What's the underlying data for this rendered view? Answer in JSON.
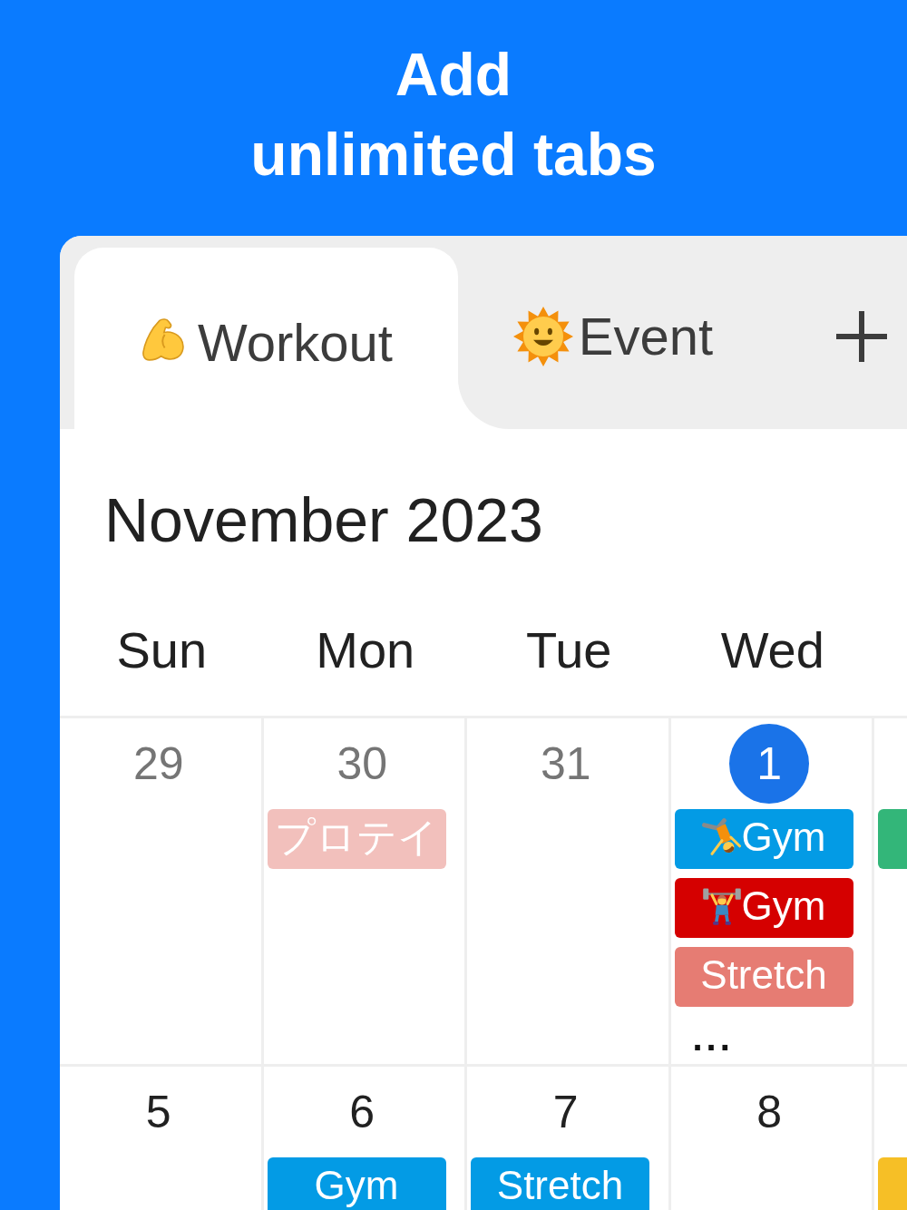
{
  "headline": "Add\nunlimited tabs",
  "tabs": [
    {
      "label": "Workout",
      "selected": true
    },
    {
      "label": "Event",
      "selected": false
    }
  ],
  "calendar": {
    "month_title": "November 2023",
    "weekdays": [
      "Sun",
      "Mon",
      "Tue",
      "Wed"
    ],
    "weeks": [
      {
        "days": [
          {
            "date": "29",
            "other_month": true,
            "today": false
          },
          {
            "date": "30",
            "other_month": true,
            "today": false,
            "events": [
              {
                "title": "プロテイ",
                "color": "#f2c0bc"
              }
            ]
          },
          {
            "date": "31",
            "other_month": true,
            "today": false
          },
          {
            "date": "1",
            "other_month": false,
            "today": true,
            "events": [
              {
                "title": "Gym",
                "color": "#039be5"
              },
              {
                "title": "Gym",
                "color": "#d50000"
              },
              {
                "title": "Stretch",
                "color": "#e67c73"
              }
            ],
            "more": "..."
          },
          {
            "events": [
              {
                "color": "#33b679"
              }
            ]
          }
        ]
      },
      {
        "days": [
          {
            "date": "5",
            "other_month": false,
            "today": false
          },
          {
            "date": "6",
            "other_month": false,
            "today": false,
            "events": [
              {
                "title": "Gym",
                "color": "#039be5"
              }
            ]
          },
          {
            "date": "7",
            "other_month": false,
            "today": false,
            "events": [
              {
                "title": "Stretch",
                "color": "#039be5"
              }
            ]
          },
          {
            "date": "8",
            "other_month": false,
            "today": false
          },
          {
            "events": [
              {
                "color": "#f6bf26"
              }
            ]
          }
        ]
      }
    ]
  }
}
